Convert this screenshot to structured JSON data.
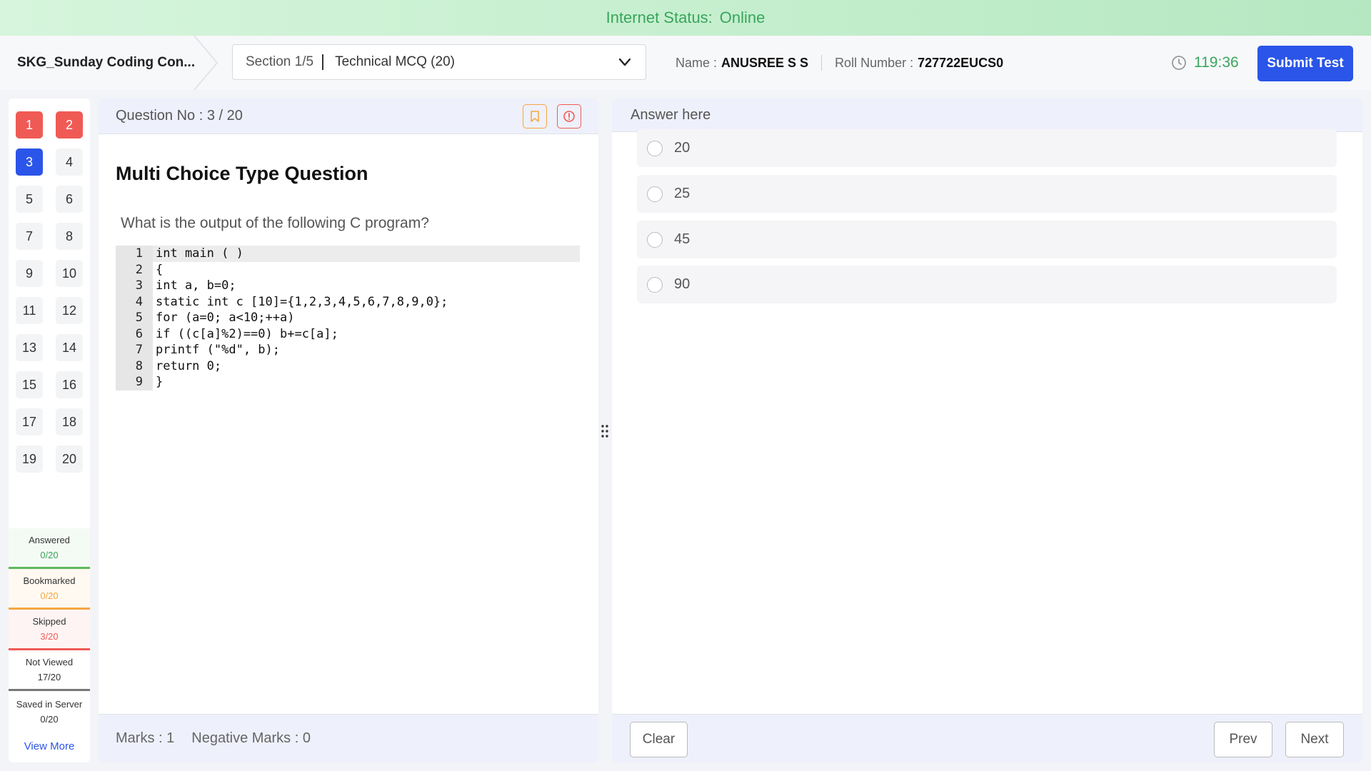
{
  "status": {
    "label": "Internet Status:",
    "value": "Online"
  },
  "header": {
    "test_title": "SKG_Sunday Coding Con...",
    "section_num": "Section 1/5",
    "section_name": "Technical MCQ (20)",
    "name_label": "Name :",
    "name_value": "ANUSREE S S",
    "roll_label": "Roll Number :",
    "roll_value": "727722EUCS0",
    "timer": "119:36",
    "submit_label": "Submit Test"
  },
  "palette": {
    "questions": [
      {
        "n": "1",
        "state": "skipped"
      },
      {
        "n": "2",
        "state": "skipped"
      },
      {
        "n": "3",
        "state": "current"
      },
      {
        "n": "4",
        "state": "not-viewed"
      },
      {
        "n": "5",
        "state": "not-viewed"
      },
      {
        "n": "6",
        "state": "not-viewed"
      },
      {
        "n": "7",
        "state": "not-viewed"
      },
      {
        "n": "8",
        "state": "not-viewed"
      },
      {
        "n": "9",
        "state": "not-viewed"
      },
      {
        "n": "10",
        "state": "not-viewed"
      },
      {
        "n": "11",
        "state": "not-viewed"
      },
      {
        "n": "12",
        "state": "not-viewed"
      },
      {
        "n": "13",
        "state": "not-viewed"
      },
      {
        "n": "14",
        "state": "not-viewed"
      },
      {
        "n": "15",
        "state": "not-viewed"
      },
      {
        "n": "16",
        "state": "not-viewed"
      },
      {
        "n": "17",
        "state": "not-viewed"
      },
      {
        "n": "18",
        "state": "not-viewed"
      },
      {
        "n": "19",
        "state": "not-viewed"
      },
      {
        "n": "20",
        "state": "not-viewed"
      }
    ],
    "legend": {
      "answered": {
        "label": "Answered",
        "count": "0/20"
      },
      "bookmarked": {
        "label": "Bookmarked",
        "count": "0/20"
      },
      "skipped": {
        "label": "Skipped",
        "count": "3/20"
      },
      "not_viewed": {
        "label": "Not Viewed",
        "count": "17/20"
      },
      "saved": {
        "label": "Saved in Server",
        "count": "0/20"
      }
    },
    "view_more": "View More"
  },
  "question": {
    "number_label": "Question No : 3 / 20",
    "type": "Multi Choice Type Question",
    "text": "What is the output of the following C program?",
    "code": [
      "int main ( )",
      "{",
      "int a, b=0;",
      "static int c [10]={1,2,3,4,5,6,7,8,9,0};",
      "for (a=0; a<10;++a)",
      "if ((c[a]%2)==0) b+=c[a];",
      "printf (\"%d\", b);",
      "return 0;",
      "}"
    ],
    "marks": "Marks : 1",
    "negative_marks": "Negative Marks : 0",
    "icons": [
      "bookmark-icon",
      "report-icon"
    ]
  },
  "answer": {
    "title": "Answer here",
    "options": [
      "20",
      "25",
      "45",
      "90"
    ],
    "clear_label": "Clear",
    "prev_label": "Prev",
    "next_label": "Next"
  },
  "colors": {
    "accent": "#2b55e8",
    "online": "#3aa55c",
    "skipped": "#f05a55",
    "bookmarked": "#f5a742"
  }
}
